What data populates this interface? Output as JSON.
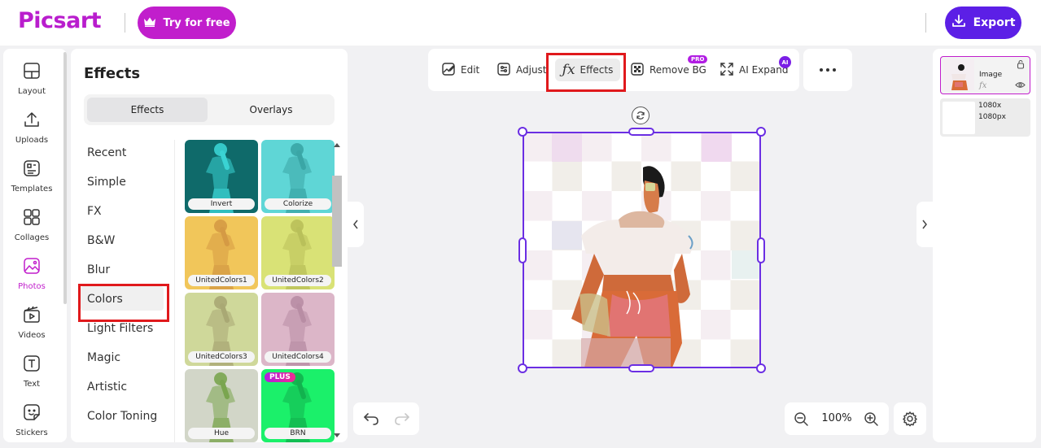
{
  "header": {
    "logo": "Picsart",
    "try_label": "Try for free",
    "export_label": "Export"
  },
  "rail": {
    "items": [
      {
        "label": "Layout",
        "icon": "layout-icon"
      },
      {
        "label": "Uploads",
        "icon": "upload-icon"
      },
      {
        "label": "Templates",
        "icon": "templates-icon"
      },
      {
        "label": "Collages",
        "icon": "collages-icon"
      },
      {
        "label": "Photos",
        "icon": "photos-icon",
        "active": true
      },
      {
        "label": "Videos",
        "icon": "videos-icon"
      },
      {
        "label": "Text",
        "icon": "text-icon"
      },
      {
        "label": "Stickers",
        "icon": "stickers-icon"
      }
    ]
  },
  "panel": {
    "title": "Effects",
    "tabs": [
      "Effects",
      "Overlays"
    ],
    "categories": [
      "Recent",
      "Simple",
      "FX",
      "B&W",
      "Blur",
      "Colors",
      "Light Filters",
      "Magic",
      "Artistic",
      "Color Toning"
    ],
    "selected_category": "Colors",
    "thumbnails": [
      {
        "label": "Invert",
        "bg": "#0f6a6a",
        "figure": "#3ad3d3"
      },
      {
        "label": "Colorize",
        "bg": "#5fd6d6",
        "figure": "#3aa6a6"
      },
      {
        "label": "UnitedColors1",
        "bg": "#f1c65a",
        "figure": "#d59a44"
      },
      {
        "label": "UnitedColors2",
        "bg": "#d9e276",
        "figure": "#b9c05a"
      },
      {
        "label": "UnitedColors3",
        "bg": "#cfd89a",
        "figure": "#a9a874"
      },
      {
        "label": "UnitedColors4",
        "bg": "#dcb6c8",
        "figure": "#b88da4"
      },
      {
        "label": "Hue",
        "bg": "#d2d6c8",
        "figure": "#7aa54f"
      },
      {
        "label": "BRN",
        "bg": "#1bf06a",
        "figure": "#12b24e",
        "badge": "PLUS"
      }
    ]
  },
  "toolbar": {
    "items": [
      {
        "label": "Edit",
        "icon": "edit-image-icon"
      },
      {
        "label": "Adjust",
        "icon": "adjust-icon"
      },
      {
        "label": "Effects",
        "icon": "fx-icon",
        "active": true
      },
      {
        "label": "Remove BG",
        "icon": "remove-bg-icon",
        "badge": "PRO"
      },
      {
        "label": "AI Expand",
        "icon": "expand-icon",
        "badge": "AI"
      }
    ],
    "more_icon": "more-dots-icon"
  },
  "zoom": {
    "value": "100%"
  },
  "layers": {
    "image_label": "Image",
    "image_fx": "fx",
    "canvas_size_line1": "1080x",
    "canvas_size_line2": "1080px"
  },
  "colors": {
    "brand": "#c11ecc",
    "export": "#5c1fe6",
    "selection": "#6b2ee3",
    "highlight": "#e0191c"
  }
}
